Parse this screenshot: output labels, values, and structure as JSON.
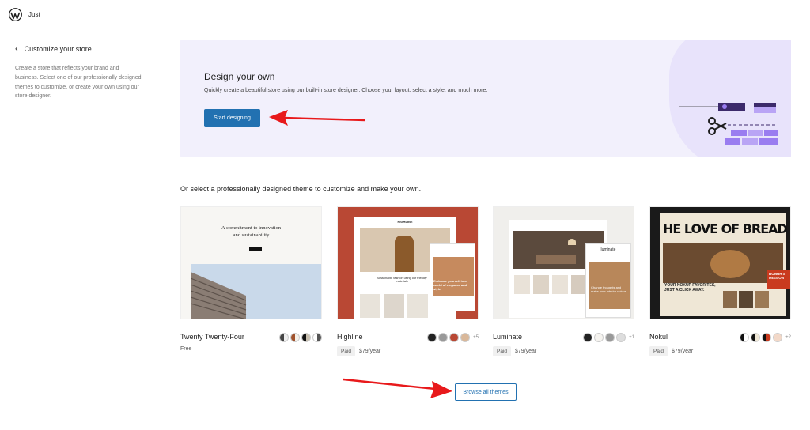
{
  "header": {
    "site_name": "Just"
  },
  "sidebar": {
    "back_label": "Customize your store",
    "description": "Create a store that reflects your brand and business. Select one of our professionally designed themes to customize, or create your own using our store designer."
  },
  "hero": {
    "title": "Design your own",
    "text": "Quickly create a beautiful store using our built-in store designer. Choose your layout, select a style, and much more.",
    "button": "Start designing",
    "accent": "#2271b1"
  },
  "subtitle": "Or select a professionally designed theme to customize and make your own.",
  "themes": [
    {
      "name": "Twenty Twenty-Four",
      "price_tag": "",
      "price": "Free",
      "more": "",
      "thumb_text": [
        "A commitment to innovation",
        "and sustainability"
      ]
    },
    {
      "name": "Highline",
      "price_tag": "Paid",
      "price": "$79/year",
      "more": "+5",
      "thumb_text": [
        "HIGHLINE",
        "Sustainable fashion using our friendly materials",
        "Embrace yourself in a world of elegance and style"
      ]
    },
    {
      "name": "Luminate",
      "price_tag": "Paid",
      "price": "$79/year",
      "more": "+1",
      "thumb_text": [
        "luminate",
        "Change thoughts and make your interior unique"
      ]
    },
    {
      "name": "Nokul",
      "price_tag": "Paid",
      "price": "$79/year",
      "more": "+2",
      "thumb_text": [
        "HE LOVE OF BREAD",
        "YOUR NOKUP FAVORITES, JUST A CLICK AWAY.",
        "BONUR'S MISSION"
      ]
    }
  ],
  "browse_button": "Browse all themes",
  "icons": [
    "wordpress-logo",
    "chevron-left-icon",
    "scissors-icon",
    "pen-icon"
  ]
}
